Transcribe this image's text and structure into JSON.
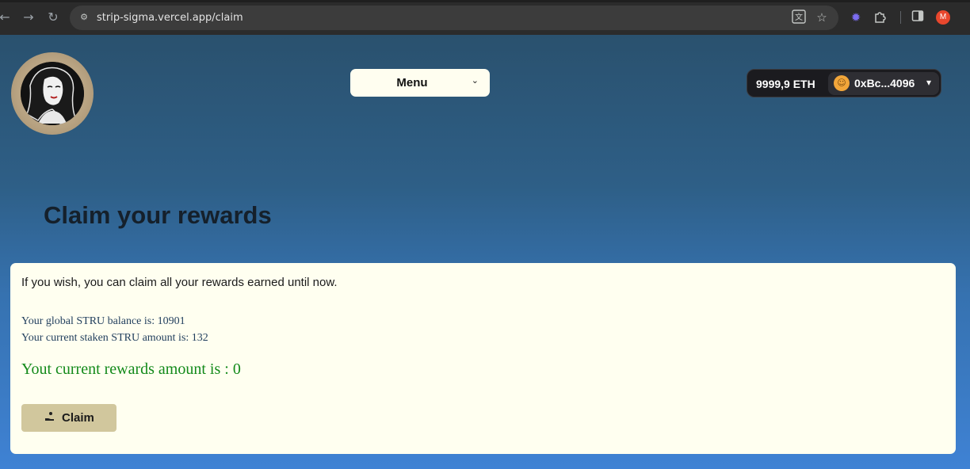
{
  "browser": {
    "url": "strip-sigma.vercel.app/claim",
    "profile_initial": "M",
    "icons": {
      "back": "arrow-left-icon",
      "forward": "arrow-right-icon",
      "reload": "reload-icon",
      "site_info": "site-settings-icon",
      "translate": "translate-icon",
      "bookmark": "star-icon",
      "extension_colored": "extension-gear-icon",
      "extensions": "puzzle-icon",
      "side_panel": "side-panel-icon"
    }
  },
  "header": {
    "menu_label": "Menu",
    "wallet": {
      "balance": "9999,9 ETH",
      "address": "0xBc...4096"
    }
  },
  "main": {
    "title": "Claim your rewards",
    "intro": "If you wish, you can claim all your rewards earned until now.",
    "balance_line": "Your global STRU balance is: 10901",
    "staked_line": "Your current staken STRU amount is: 132",
    "rewards_line": "Yout current rewards amount is : 0",
    "claim_label": "Claim"
  },
  "colors": {
    "card_bg": "#fffff0",
    "claim_button": "#d1c79d",
    "rewards_text": "#138a1a",
    "menu_bg": "#fffef0"
  }
}
